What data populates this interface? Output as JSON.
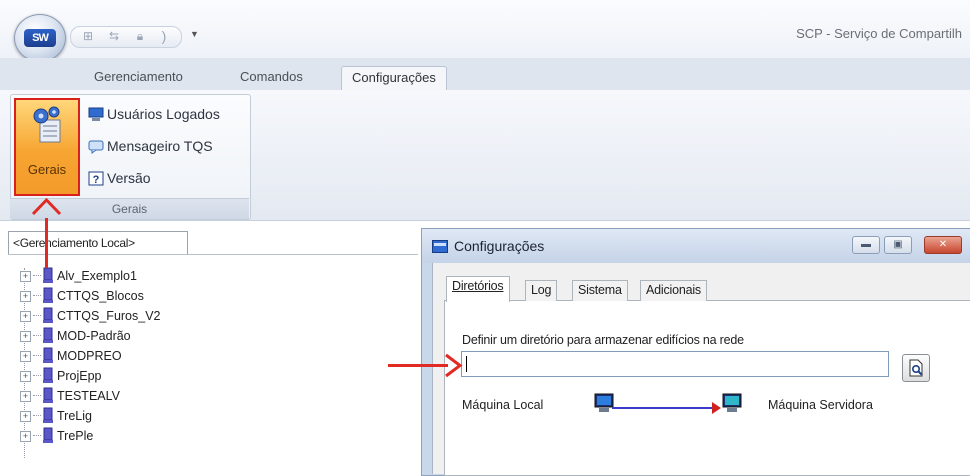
{
  "app": {
    "title": "SCP - Serviço de Compartilh",
    "orb_logo": "SW"
  },
  "ribbon": {
    "tabs": [
      {
        "label": "Gerenciamento"
      },
      {
        "label": "Comandos"
      },
      {
        "label": "Configurações",
        "active": true
      }
    ],
    "group": {
      "label": "Gerais",
      "large_button": {
        "label": "Gerais",
        "icon": "settings-gears-icon",
        "highlighted": true
      },
      "small_buttons": [
        {
          "label": "Usuários Logados",
          "icon": "users-icon"
        },
        {
          "label": "Mensageiro TQS",
          "icon": "message-icon"
        },
        {
          "label": "Versão",
          "icon": "help-icon"
        }
      ]
    }
  },
  "tree": {
    "tab_label": "<Gerenciamento Local>",
    "items": [
      {
        "label": "Alv_Exemplo1"
      },
      {
        "label": "CTTQS_Blocos"
      },
      {
        "label": "CTTQS_Furos_V2"
      },
      {
        "label": "MOD-Padrão"
      },
      {
        "label": "MODPREO"
      },
      {
        "label": "ProjEpp"
      },
      {
        "label": "TESTEALV"
      },
      {
        "label": "TreLig"
      },
      {
        "label": "TrePle"
      }
    ]
  },
  "dialog": {
    "title": "Configurações",
    "tabs": [
      {
        "label": "Diretórios",
        "active": true
      },
      {
        "label": "Log"
      },
      {
        "label": "Sistema"
      },
      {
        "label": "Adicionais"
      }
    ],
    "directory_label": "Definir um diretório para armazenar edifícios na rede",
    "directory_value": "",
    "local_machine_label": "Máquina Local",
    "server_machine_label": "Máquina Servidora"
  },
  "colors": {
    "highlight_border": "#d8201c",
    "active_button": "#f7a532",
    "connection_line": "#3a3acb",
    "annotation_arrow": "#e22a24"
  }
}
